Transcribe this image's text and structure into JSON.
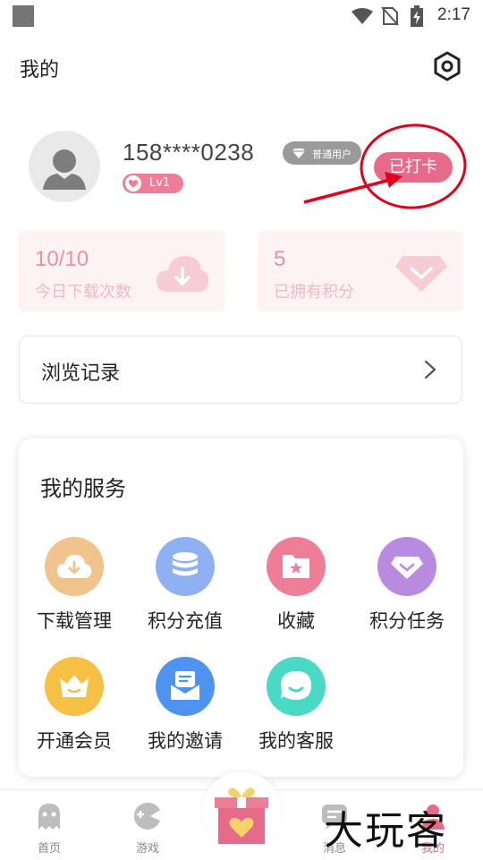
{
  "status_bar": {
    "time": "2:17"
  },
  "header": {
    "title": "我的"
  },
  "profile": {
    "phone": "158****0238",
    "level": "Lv1",
    "member_type": "普通用户",
    "checkin_label": "已打卡"
  },
  "stats": [
    {
      "value": "10/10",
      "label": "今日下载次数",
      "icon": "cloud-download-icon"
    },
    {
      "value": "5",
      "label": "已拥有积分",
      "icon": "diamond-icon"
    }
  ],
  "history": {
    "label": "浏览记录"
  },
  "services": {
    "title": "我的服务",
    "items": [
      {
        "label": "下载管理",
        "icon": "download-cloud-icon",
        "color": "#f0c48c"
      },
      {
        "label": "积分充值",
        "icon": "coins-stack-icon",
        "color": "#8fb1f3"
      },
      {
        "label": "收藏",
        "icon": "favorite-folder-icon",
        "color": "#ee7d97"
      },
      {
        "label": "积分任务",
        "icon": "diamond-icon",
        "color": "#b98be0"
      },
      {
        "label": "开通会员",
        "icon": "crown-icon",
        "color": "#f5c044"
      },
      {
        "label": "我的邀请",
        "icon": "mail-icon",
        "color": "#4f93f0"
      },
      {
        "label": "我的客服",
        "icon": "chat-bubble-icon",
        "color": "#4ad9c4"
      }
    ]
  },
  "bottom_nav": [
    {
      "label": "首页",
      "icon": "ghost-icon"
    },
    {
      "label": "游戏",
      "icon": "gamepad-icon"
    },
    {
      "label": "消息",
      "icon": "message-icon"
    },
    {
      "label": "我的",
      "icon": "profile-icon",
      "active": true
    }
  ],
  "watermark": "大玩客",
  "colors": {
    "accent": "#e86a8a",
    "pink_light": "#fdf3f4",
    "annotation_red": "#e0001b"
  }
}
